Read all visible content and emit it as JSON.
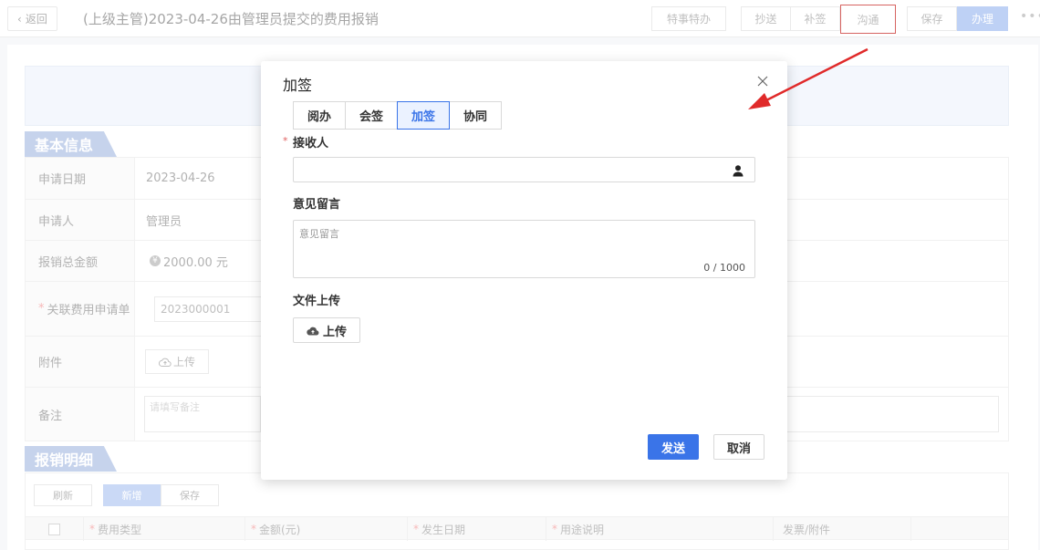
{
  "header": {
    "back_label": "返回",
    "title": "(上级主管)2023-04-26由管理员提交的费用报销",
    "buttons": {
      "special": "特事特办",
      "cc": "抄送",
      "supplement": "补签",
      "communicate": "沟通",
      "save": "保存",
      "handle": "办理"
    }
  },
  "sections": {
    "basic_info": "基本信息",
    "details": "报销明细"
  },
  "form": {
    "apply_date": {
      "label": "申请日期",
      "value": "2023-04-26"
    },
    "applicant": {
      "label": "申请人",
      "value": "管理员"
    },
    "total_amount": {
      "label": "报销总金额",
      "value": "2000.00 元",
      "icon": "¥"
    },
    "related_form": {
      "label": "关联费用申请单",
      "value": "2023000001"
    },
    "attachment": {
      "label": "附件",
      "upload": "上传"
    },
    "remark": {
      "label": "备注",
      "placeholder": "请填写备注"
    }
  },
  "detail_toolbar": {
    "refresh": "刷新",
    "add": "新增",
    "save": "保存"
  },
  "detail_table": {
    "columns": [
      "费用类型",
      "金额(元)",
      "发生日期",
      "用途说明",
      "发票/附件"
    ]
  },
  "modal": {
    "title": "加签",
    "tabs": [
      "阅办",
      "会签",
      "加签",
      "协同"
    ],
    "active_tab": "加签",
    "receiver_label": "接收人",
    "receiver_required": "*",
    "receiver_value": "",
    "comment_label": "意见留言",
    "comment_placeholder": "意见留言",
    "comment_count": "0 / 1000",
    "upload_label": "文件上传",
    "upload_button": "上传",
    "send_button": "发送",
    "cancel_button": "取消"
  },
  "colors": {
    "accent": "#3a74e8",
    "highlight_box": "#c9302c",
    "annotation_arrow": "#e02a2a"
  }
}
